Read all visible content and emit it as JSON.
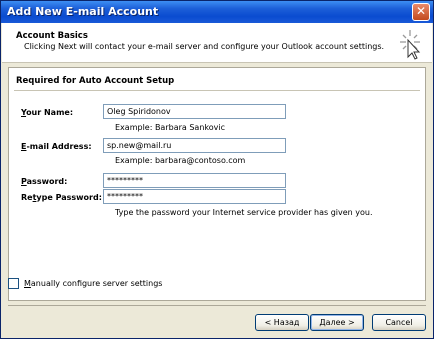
{
  "window": {
    "title": "Add New E-mail Account",
    "close_label": "✕"
  },
  "header": {
    "title": "Account Basics",
    "description": "Clicking Next will contact your e-mail server and configure your Outlook account settings."
  },
  "section": {
    "title": "Required for Auto Account Setup"
  },
  "fields": {
    "name": {
      "label_u": "Y",
      "label_rest": "our Name:",
      "value": "Oleg Spiridonov",
      "hint": "Example: Barbara Sankovic"
    },
    "email": {
      "label_u": "E",
      "label_rest": "-mail Address:",
      "value": "sp.new@mail.ru",
      "hint": "Example: barbara@contoso.com"
    },
    "password": {
      "label_u": "P",
      "label_rest": "assword:",
      "value": "*********"
    },
    "retype": {
      "label_pre": "Re",
      "label_u": "t",
      "label_rest": "ype Password:",
      "value": "*********",
      "hint": "Type the password your Internet service provider has given you."
    }
  },
  "manual": {
    "label_u": "M",
    "label_rest": "anually configure server settings",
    "checked": false
  },
  "buttons": {
    "back": "< Назад",
    "next": "Далее >",
    "cancel": "Cancel"
  }
}
